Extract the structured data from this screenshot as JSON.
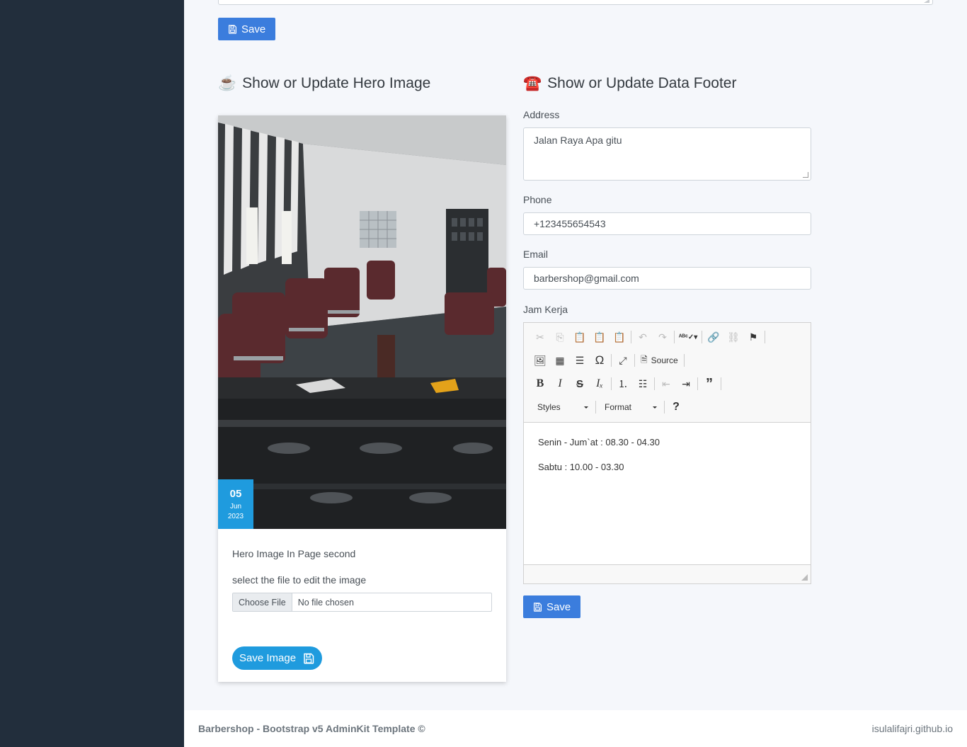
{
  "top": {
    "save_label": "Save"
  },
  "hero_section": {
    "emoji": "☕",
    "title": "Show or Update Hero Image",
    "date": {
      "day": "05",
      "month": "Jun",
      "year": "2023"
    },
    "caption": "Hero Image In Page second",
    "file_prompt": "select the file to edit the image",
    "choose_label": "Choose File",
    "file_status": "No file chosen",
    "save_label": "Save Image"
  },
  "footer_section": {
    "emoji": "☎️",
    "title": "Show or Update Data Footer",
    "address_label": "Address",
    "address_value": "Jalan Raya Apa gitu",
    "phone_label": "Phone",
    "phone_value": "+123455654543",
    "email_label": "Email",
    "email_value": "barbershop@gmail.com",
    "hours_label": "Jam Kerja",
    "editor": {
      "source_label": "Source",
      "styles_label": "Styles",
      "format_label": "Format",
      "lines": [
        "Senin - Jum`at : 08.30 - 04.30",
        "Sabtu : 10.00 - 03.30"
      ]
    },
    "save_label": "Save"
  },
  "footer": {
    "left": "Barbershop - Bootstrap v5 AdminKit Template ©",
    "right": "isulalifajri.github.io"
  },
  "colors": {
    "sidebar": "#222e3c",
    "primary": "#3b7ddd",
    "accent": "#1f9bde",
    "background": "#f5f7fb"
  }
}
